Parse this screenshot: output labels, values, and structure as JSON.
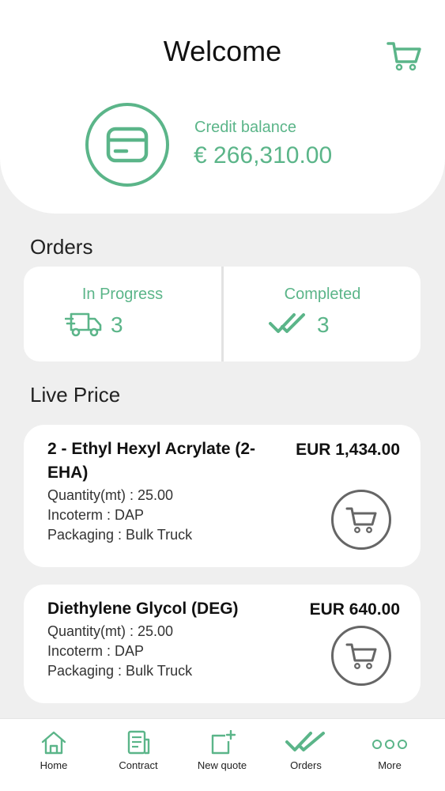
{
  "header": {
    "title": "Welcome",
    "cart_icon": "cart-icon"
  },
  "credit": {
    "label": "Credit balance",
    "amount": "€ 266,310.00",
    "icon": "credit-card-icon"
  },
  "orders": {
    "title": "Orders",
    "in_progress": {
      "label": "In Progress",
      "count": "3",
      "icon": "delivery-truck-icon"
    },
    "completed": {
      "label": "Completed",
      "count": "3",
      "icon": "double-check-icon"
    }
  },
  "live_price": {
    "title": "Live Price",
    "items": [
      {
        "name_line1": "2 - Ethyl Hexyl Acrylate (2-",
        "name_line2": "EHA)",
        "price": "EUR 1,434.00",
        "quantity": "Quantity(mt) : 25.00",
        "incoterm": "Incoterm : DAP",
        "packaging": "Packaging : Bulk Truck"
      },
      {
        "name_line1": "Diethylene Glycol (DEG)",
        "price": "EUR 640.00",
        "quantity": "Quantity(mt) : 25.00",
        "incoterm": "Incoterm : DAP",
        "packaging": "Packaging : Bulk Truck"
      }
    ]
  },
  "tabbar": {
    "items": [
      {
        "label": "Home",
        "icon": "home-icon"
      },
      {
        "label": "Contract",
        "icon": "contract-icon"
      },
      {
        "label": "New quote",
        "icon": "new-quote-icon"
      },
      {
        "label": "Orders",
        "icon": "double-check-icon"
      },
      {
        "label": "More",
        "icon": "more-dots-icon"
      }
    ]
  },
  "colors": {
    "accent": "#5bb589",
    "background": "#efefef",
    "card": "#ffffff"
  }
}
